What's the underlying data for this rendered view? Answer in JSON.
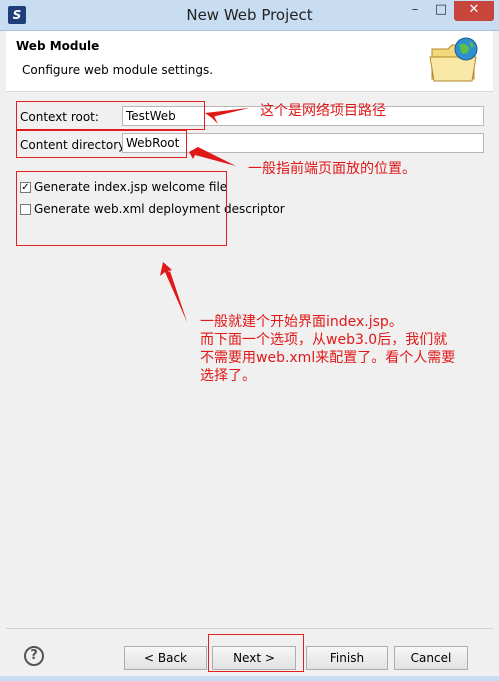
{
  "window": {
    "title": "New Web Project",
    "minimize_label": "–",
    "maximize_label": "□",
    "close_label": "✕",
    "app_icon_glyph": "S"
  },
  "header": {
    "title": "Web Module",
    "description": "Configure web module settings."
  },
  "form": {
    "context_root": {
      "label": "Context root:",
      "value": "TestWeb"
    },
    "content_directory": {
      "label": "Content directory:",
      "value": "WebRoot"
    },
    "generate_index": {
      "label": "Generate index.jsp welcome file",
      "checked": true
    },
    "generate_webxml": {
      "label": "Generate web.xml deployment descriptor",
      "checked": false
    }
  },
  "annotations": {
    "context_root_note": "这个是网络项目路径",
    "content_dir_note": "一般指前端页面放的位置。",
    "options_note": [
      "一般就建个开始界面index.jsp。",
      "而下面一个选项，从web3.0后，我们就",
      "不需要用web.xml来配置了。看个人需要",
      "选择了。"
    ]
  },
  "buttons": {
    "back": "< Back",
    "next": "Next >",
    "finish": "Finish",
    "cancel": "Cancel"
  },
  "colors": {
    "annotation_red": "#e01818",
    "title_bar": "#c8ddf2",
    "close_button": "#c7453a"
  },
  "icons": {
    "help": "help-icon",
    "header": "web-folder-icon",
    "app": "app-logo-icon"
  }
}
